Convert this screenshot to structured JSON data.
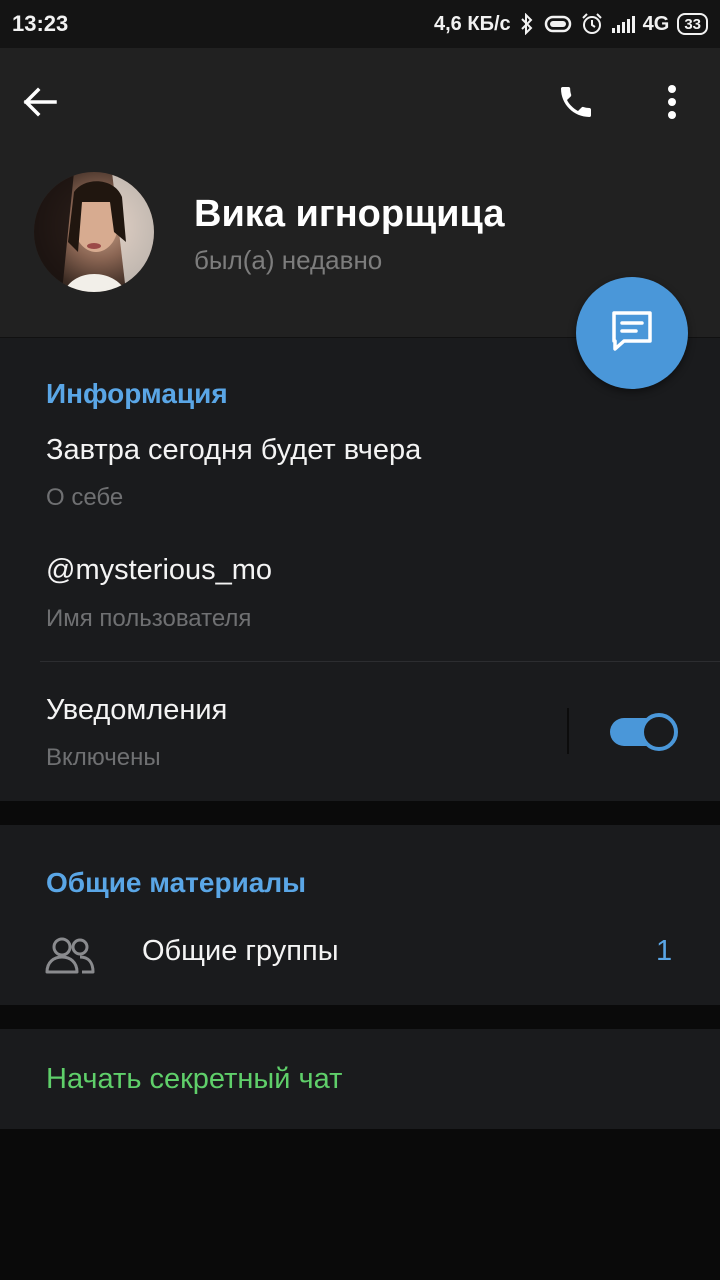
{
  "status_bar": {
    "time": "13:23",
    "speed": "4,6 КБ/с",
    "network": "4G",
    "battery": "33",
    "icons": [
      "bluetooth-icon",
      "vibrate-icon",
      "alarm-icon",
      "signal-icon"
    ]
  },
  "header": {
    "back_icon": "arrow-back-icon",
    "call_icon": "phone-icon",
    "more_icon": "more-vert-icon"
  },
  "profile": {
    "name": "Вика игнорщица",
    "status": "был(а) недавно"
  },
  "fab": {
    "icon": "message-icon"
  },
  "info": {
    "title": "Информация",
    "bio": "Завтра сегодня будет вчера",
    "bio_label": "О себе",
    "username": "@mysterious_mo",
    "username_label": "Имя пользователя",
    "notifications": "Уведомления",
    "notifications_state": "Включены",
    "notifications_on": true
  },
  "shared": {
    "title": "Общие материалы",
    "groups_label": "Общие группы",
    "groups_count": "1"
  },
  "secret_chat": {
    "label": "Начать секретный чат"
  },
  "colors": {
    "accent": "#4a97d9",
    "section_title": "#5aa6e6",
    "secret": "#5fcf6a",
    "background": "#1a1b1d",
    "header": "#212121"
  }
}
